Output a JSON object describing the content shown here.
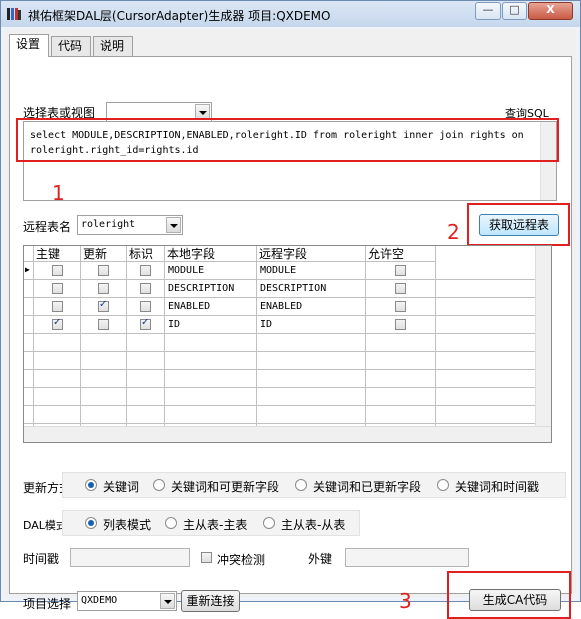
{
  "window": {
    "title": "祺佑框架DAL层(CursorAdapter)生成器 项目:QXDEMO",
    "minimize": "—",
    "maximize": "□",
    "close": "X"
  },
  "tabs": [
    "设置",
    "代码",
    "说明"
  ],
  "select_table_label": "选择表或视图",
  "select_table_value": "",
  "query_sql_label": "查询SQL",
  "sql_text": "select MODULE,DESCRIPTION,ENABLED,roleright.ID from roleright inner join  rights on roleright.right_id=rights.id",
  "remote_table_label": "远程表名",
  "remote_table_value": "roleright",
  "fetch_remote_button": "获取远程表",
  "annotations": [
    "1",
    "2",
    "3"
  ],
  "grid": {
    "headers": [
      "主键",
      "更新",
      "标识",
      "本地字段",
      "远程字段",
      "允许空"
    ],
    "rows": [
      {
        "pk": false,
        "update": false,
        "ident": false,
        "local": "MODULE",
        "remote": "MODULE",
        "nullable": false
      },
      {
        "pk": false,
        "update": false,
        "ident": false,
        "local": "DESCRIPTION",
        "remote": "DESCRIPTION",
        "nullable": false
      },
      {
        "pk": false,
        "update": true,
        "ident": false,
        "local": "ENABLED",
        "remote": "ENABLED",
        "nullable": false
      },
      {
        "pk": true,
        "update": false,
        "ident": true,
        "local": "ID",
        "remote": "ID",
        "nullable": false
      }
    ]
  },
  "update_mode": {
    "label": "更新方式",
    "options": [
      "关键词",
      "关键词和可更新字段",
      "关键词和已更新字段",
      "关键词和时间戳"
    ],
    "selected": 0
  },
  "dal_mode": {
    "label": "DAL模式",
    "options": [
      "列表模式",
      "主从表-主表",
      "主从表-从表"
    ],
    "selected": 0
  },
  "timestamp_label": "时间戳",
  "timestamp_value": "",
  "conflict_check_label": "冲突检测",
  "foreign_key_label": "外键",
  "foreign_key_value": "",
  "project_label": "项目选择",
  "project_value": "QXDEMO",
  "reconnect_button": "重新连接",
  "generate_button": "生成CA代码"
}
